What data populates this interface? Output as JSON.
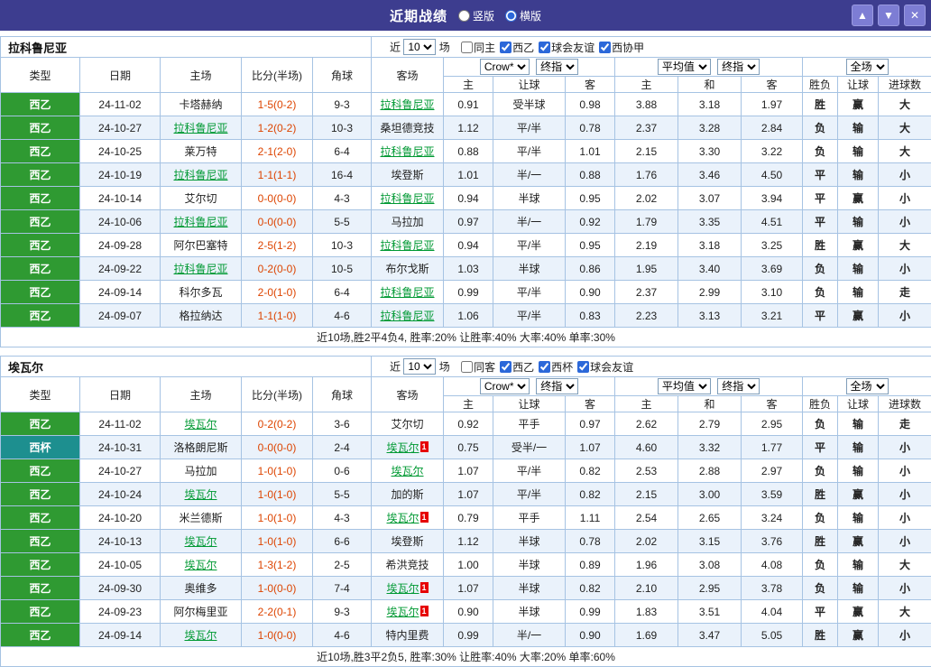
{
  "colors": {
    "topbar_bg": "#3D3D8F",
    "topbar_button_bg": "#7D7DD4",
    "grid_border": "#A6C3E3",
    "row_alt_bg": "#EAF2FB",
    "league_green": "#2F9A32",
    "league_teal": "#1D8F8F",
    "team_link": "#009933",
    "score_red": "#DD4400",
    "summary_red": "#DD2200",
    "result_red": "#EE0000",
    "result_blue": "#2233CC",
    "result_teal": "#009999",
    "result_green": "#00A050",
    "checkbox_accent": "#2C68D9"
  },
  "header": {
    "title": "近期战绩",
    "vertical_label": "竖版",
    "horizontal_label": "横版",
    "selected_layout": "horizontal",
    "up_button": "▲",
    "down_button": "▼",
    "close_button": "✕"
  },
  "columns": [
    "类型",
    "日期",
    "主场",
    "比分(半场)",
    "角球",
    "客场",
    "主",
    "让球",
    "客",
    "主",
    "和",
    "客",
    "胜负",
    "让球",
    "进球数"
  ],
  "sections": [
    {
      "team": "拉科鲁尼亚",
      "filter": {
        "near_label": "近",
        "games_value": "10",
        "games_label": "场",
        "checkboxes": [
          {
            "label": "同主",
            "checked": false
          },
          {
            "label": "西乙",
            "checked": true
          },
          {
            "label": "球会友谊",
            "checked": true
          },
          {
            "label": "西协甲",
            "checked": true
          }
        ]
      },
      "selects": {
        "company": "Crow*",
        "final1": "终指",
        "average": "平均值",
        "final2": "终指",
        "scope": "全场"
      },
      "rows": [
        {
          "league": "西乙",
          "league_color": "green",
          "date": "24-11-02",
          "home": "卡塔赫纳",
          "home_focus": false,
          "score": "1-5(0-2)",
          "corner": "9-3",
          "away": "拉科鲁尼亚",
          "away_focus": true,
          "odds": [
            "0.91",
            "受半球",
            "0.98"
          ],
          "avg": [
            "3.88",
            "3.18",
            "1.97"
          ],
          "result": {
            "text": "胜",
            "color": "red"
          },
          "handicap_result": {
            "text": "赢",
            "color": "red"
          },
          "goals": {
            "text": "大",
            "color": "red"
          }
        },
        {
          "league": "西乙",
          "league_color": "green",
          "date": "24-10-27",
          "home": "拉科鲁尼亚",
          "home_focus": true,
          "score": "1-2(0-2)",
          "corner": "10-3",
          "away": "桑坦德竞技",
          "away_focus": false,
          "odds": [
            "1.12",
            "平/半",
            "0.78"
          ],
          "avg": [
            "2.37",
            "3.28",
            "2.84"
          ],
          "result": {
            "text": "负",
            "color": "blue"
          },
          "handicap_result": {
            "text": "输",
            "color": "blue"
          },
          "goals": {
            "text": "大",
            "color": "red"
          }
        },
        {
          "league": "西乙",
          "league_color": "green",
          "date": "24-10-25",
          "home": "莱万特",
          "home_focus": false,
          "score": "2-1(2-0)",
          "corner": "6-4",
          "away": "拉科鲁尼亚",
          "away_focus": true,
          "odds": [
            "0.88",
            "平/半",
            "1.01"
          ],
          "avg": [
            "2.15",
            "3.30",
            "3.22"
          ],
          "result": {
            "text": "负",
            "color": "blue"
          },
          "handicap_result": {
            "text": "输",
            "color": "blue"
          },
          "goals": {
            "text": "大",
            "color": "red"
          }
        },
        {
          "league": "西乙",
          "league_color": "green",
          "date": "24-10-19",
          "home": "拉科鲁尼亚",
          "home_focus": true,
          "score": "1-1(1-1)",
          "corner": "16-4",
          "away": "埃登斯",
          "away_focus": false,
          "odds": [
            "1.01",
            "半/一",
            "0.88"
          ],
          "avg": [
            "1.76",
            "3.46",
            "4.50"
          ],
          "result": {
            "text": "平",
            "color": "teal"
          },
          "handicap_result": {
            "text": "输",
            "color": "blue"
          },
          "goals": {
            "text": "小",
            "color": "blue"
          }
        },
        {
          "league": "西乙",
          "league_color": "green",
          "date": "24-10-14",
          "home": "艾尔切",
          "home_focus": false,
          "score": "0-0(0-0)",
          "corner": "4-3",
          "away": "拉科鲁尼亚",
          "away_focus": true,
          "odds": [
            "0.94",
            "半球",
            "0.95"
          ],
          "avg": [
            "2.02",
            "3.07",
            "3.94"
          ],
          "result": {
            "text": "平",
            "color": "teal"
          },
          "handicap_result": {
            "text": "赢",
            "color": "red"
          },
          "goals": {
            "text": "小",
            "color": "blue"
          }
        },
        {
          "league": "西乙",
          "league_color": "green",
          "date": "24-10-06",
          "home": "拉科鲁尼亚",
          "home_focus": true,
          "score": "0-0(0-0)",
          "corner": "5-5",
          "away": "马拉加",
          "away_focus": false,
          "odds": [
            "0.97",
            "半/一",
            "0.92"
          ],
          "avg": [
            "1.79",
            "3.35",
            "4.51"
          ],
          "result": {
            "text": "平",
            "color": "teal"
          },
          "handicap_result": {
            "text": "输",
            "color": "blue"
          },
          "goals": {
            "text": "小",
            "color": "blue"
          }
        },
        {
          "league": "西乙",
          "league_color": "green",
          "date": "24-09-28",
          "home": "阿尔巴塞特",
          "home_focus": false,
          "score": "2-5(1-2)",
          "corner": "10-3",
          "away": "拉科鲁尼亚",
          "away_focus": true,
          "odds": [
            "0.94",
            "平/半",
            "0.95"
          ],
          "avg": [
            "2.19",
            "3.18",
            "3.25"
          ],
          "result": {
            "text": "胜",
            "color": "red"
          },
          "handicap_result": {
            "text": "赢",
            "color": "red"
          },
          "goals": {
            "text": "大",
            "color": "red"
          }
        },
        {
          "league": "西乙",
          "league_color": "green",
          "date": "24-09-22",
          "home": "拉科鲁尼亚",
          "home_focus": true,
          "score": "0-2(0-0)",
          "corner": "10-5",
          "away": "布尔戈斯",
          "away_focus": false,
          "odds": [
            "1.03",
            "半球",
            "0.86"
          ],
          "avg": [
            "1.95",
            "3.40",
            "3.69"
          ],
          "result": {
            "text": "负",
            "color": "blue"
          },
          "handicap_result": {
            "text": "输",
            "color": "blue"
          },
          "goals": {
            "text": "小",
            "color": "blue"
          }
        },
        {
          "league": "西乙",
          "league_color": "green",
          "date": "24-09-14",
          "home": "科尔多瓦",
          "home_focus": false,
          "score": "2-0(1-0)",
          "corner": "6-4",
          "away": "拉科鲁尼亚",
          "away_focus": true,
          "odds": [
            "0.99",
            "平/半",
            "0.90"
          ],
          "avg": [
            "2.37",
            "2.99",
            "3.10"
          ],
          "result": {
            "text": "负",
            "color": "blue"
          },
          "handicap_result": {
            "text": "输",
            "color": "blue"
          },
          "goals": {
            "text": "走",
            "color": "green"
          }
        },
        {
          "league": "西乙",
          "league_color": "green",
          "date": "24-09-07",
          "home": "格拉纳达",
          "home_focus": false,
          "score": "1-1(1-0)",
          "corner": "4-6",
          "away": "拉科鲁尼亚",
          "away_focus": true,
          "odds": [
            "1.06",
            "平/半",
            "0.83"
          ],
          "avg": [
            "2.23",
            "3.13",
            "3.21"
          ],
          "result": {
            "text": "平",
            "color": "teal"
          },
          "handicap_result": {
            "text": "赢",
            "color": "red"
          },
          "goals": {
            "text": "小",
            "color": "blue"
          }
        }
      ],
      "summary": "近10场,胜2平4负4, 胜率:20% 让胜率:40% 大率:40% 单率:30%"
    },
    {
      "team": "埃瓦尔",
      "filter": {
        "near_label": "近",
        "games_value": "10",
        "games_label": "场",
        "checkboxes": [
          {
            "label": "同客",
            "checked": false
          },
          {
            "label": "西乙",
            "checked": true
          },
          {
            "label": "西杯",
            "checked": true
          },
          {
            "label": "球会友谊",
            "checked": true
          }
        ]
      },
      "selects": {
        "company": "Crow*",
        "final1": "终指",
        "average": "平均值",
        "final2": "终指",
        "scope": "全场"
      },
      "rows": [
        {
          "league": "西乙",
          "league_color": "green",
          "date": "24-11-02",
          "home": "埃瓦尔",
          "home_focus": true,
          "score": "0-2(0-2)",
          "corner": "3-6",
          "away": "艾尔切",
          "away_focus": false,
          "odds": [
            "0.92",
            "平手",
            "0.97"
          ],
          "avg": [
            "2.62",
            "2.79",
            "2.95"
          ],
          "result": {
            "text": "负",
            "color": "blue"
          },
          "handicap_result": {
            "text": "输",
            "color": "blue"
          },
          "goals": {
            "text": "走",
            "color": "green"
          }
        },
        {
          "league": "西杯",
          "league_color": "teal",
          "date": "24-10-31",
          "home": "洛格朗尼斯",
          "home_focus": false,
          "score": "0-0(0-0)",
          "corner": "2-4",
          "away": "埃瓦尔",
          "away_focus": true,
          "away_badge": "1",
          "odds": [
            "0.75",
            "受半/一",
            "1.07"
          ],
          "avg": [
            "4.60",
            "3.32",
            "1.77"
          ],
          "result": {
            "text": "平",
            "color": "teal"
          },
          "handicap_result": {
            "text": "输",
            "color": "blue"
          },
          "goals": {
            "text": "小",
            "color": "blue"
          }
        },
        {
          "league": "西乙",
          "league_color": "green",
          "date": "24-10-27",
          "home": "马拉加",
          "home_focus": false,
          "score": "1-0(1-0)",
          "corner": "0-6",
          "away": "埃瓦尔",
          "away_focus": true,
          "odds": [
            "1.07",
            "平/半",
            "0.82"
          ],
          "avg": [
            "2.53",
            "2.88",
            "2.97"
          ],
          "result": {
            "text": "负",
            "color": "blue"
          },
          "handicap_result": {
            "text": "输",
            "color": "blue"
          },
          "goals": {
            "text": "小",
            "color": "blue"
          }
        },
        {
          "league": "西乙",
          "league_color": "green",
          "date": "24-10-24",
          "home": "埃瓦尔",
          "home_focus": true,
          "score": "1-0(1-0)",
          "corner": "5-5",
          "away": "加的斯",
          "away_focus": false,
          "odds": [
            "1.07",
            "平/半",
            "0.82"
          ],
          "avg": [
            "2.15",
            "3.00",
            "3.59"
          ],
          "result": {
            "text": "胜",
            "color": "red"
          },
          "handicap_result": {
            "text": "赢",
            "color": "red"
          },
          "goals": {
            "text": "小",
            "color": "blue"
          }
        },
        {
          "league": "西乙",
          "league_color": "green",
          "date": "24-10-20",
          "home": "米兰德斯",
          "home_focus": false,
          "score": "1-0(1-0)",
          "corner": "4-3",
          "away": "埃瓦尔",
          "away_focus": true,
          "away_badge": "1",
          "odds": [
            "0.79",
            "平手",
            "1.11"
          ],
          "avg": [
            "2.54",
            "2.65",
            "3.24"
          ],
          "result": {
            "text": "负",
            "color": "blue"
          },
          "handicap_result": {
            "text": "输",
            "color": "blue"
          },
          "goals": {
            "text": "小",
            "color": "blue"
          }
        },
        {
          "league": "西乙",
          "league_color": "green",
          "date": "24-10-13",
          "home": "埃瓦尔",
          "home_focus": true,
          "score": "1-0(1-0)",
          "corner": "6-6",
          "away": "埃登斯",
          "away_focus": false,
          "odds": [
            "1.12",
            "半球",
            "0.78"
          ],
          "avg": [
            "2.02",
            "3.15",
            "3.76"
          ],
          "result": {
            "text": "胜",
            "color": "red"
          },
          "handicap_result": {
            "text": "赢",
            "color": "red"
          },
          "goals": {
            "text": "小",
            "color": "blue"
          }
        },
        {
          "league": "西乙",
          "league_color": "green",
          "date": "24-10-05",
          "home": "埃瓦尔",
          "home_focus": true,
          "score": "1-3(1-2)",
          "corner": "2-5",
          "away": "希洪竞技",
          "away_focus": false,
          "odds": [
            "1.00",
            "半球",
            "0.89"
          ],
          "avg": [
            "1.96",
            "3.08",
            "4.08"
          ],
          "result": {
            "text": "负",
            "color": "blue"
          },
          "handicap_result": {
            "text": "输",
            "color": "blue"
          },
          "goals": {
            "text": "大",
            "color": "red"
          }
        },
        {
          "league": "西乙",
          "league_color": "green",
          "date": "24-09-30",
          "home": "奥维多",
          "home_focus": false,
          "score": "1-0(0-0)",
          "corner": "7-4",
          "away": "埃瓦尔",
          "away_focus": true,
          "away_badge": "1",
          "odds": [
            "1.07",
            "半球",
            "0.82"
          ],
          "avg": [
            "2.10",
            "2.95",
            "3.78"
          ],
          "result": {
            "text": "负",
            "color": "blue"
          },
          "handicap_result": {
            "text": "输",
            "color": "blue"
          },
          "goals": {
            "text": "小",
            "color": "blue"
          }
        },
        {
          "league": "西乙",
          "league_color": "green",
          "date": "24-09-23",
          "home": "阿尔梅里亚",
          "home_focus": false,
          "score": "2-2(0-1)",
          "corner": "9-3",
          "away": "埃瓦尔",
          "away_focus": true,
          "away_badge": "1",
          "odds": [
            "0.90",
            "半球",
            "0.99"
          ],
          "avg": [
            "1.83",
            "3.51",
            "4.04"
          ],
          "result": {
            "text": "平",
            "color": "teal"
          },
          "handicap_result": {
            "text": "赢",
            "color": "red"
          },
          "goals": {
            "text": "大",
            "color": "red"
          }
        },
        {
          "league": "西乙",
          "league_color": "green",
          "date": "24-09-14",
          "home": "埃瓦尔",
          "home_focus": true,
          "score": "1-0(0-0)",
          "corner": "4-6",
          "away": "特内里费",
          "away_focus": false,
          "odds": [
            "0.99",
            "半/一",
            "0.90"
          ],
          "avg": [
            "1.69",
            "3.47",
            "5.05"
          ],
          "result": {
            "text": "胜",
            "color": "red"
          },
          "handicap_result": {
            "text": "赢",
            "color": "red"
          },
          "goals": {
            "text": "小",
            "color": "blue"
          }
        }
      ],
      "summary": "近10场,胜3平2负5, 胜率:30% 让胜率:40% 大率:20% 单率:60%"
    }
  ]
}
